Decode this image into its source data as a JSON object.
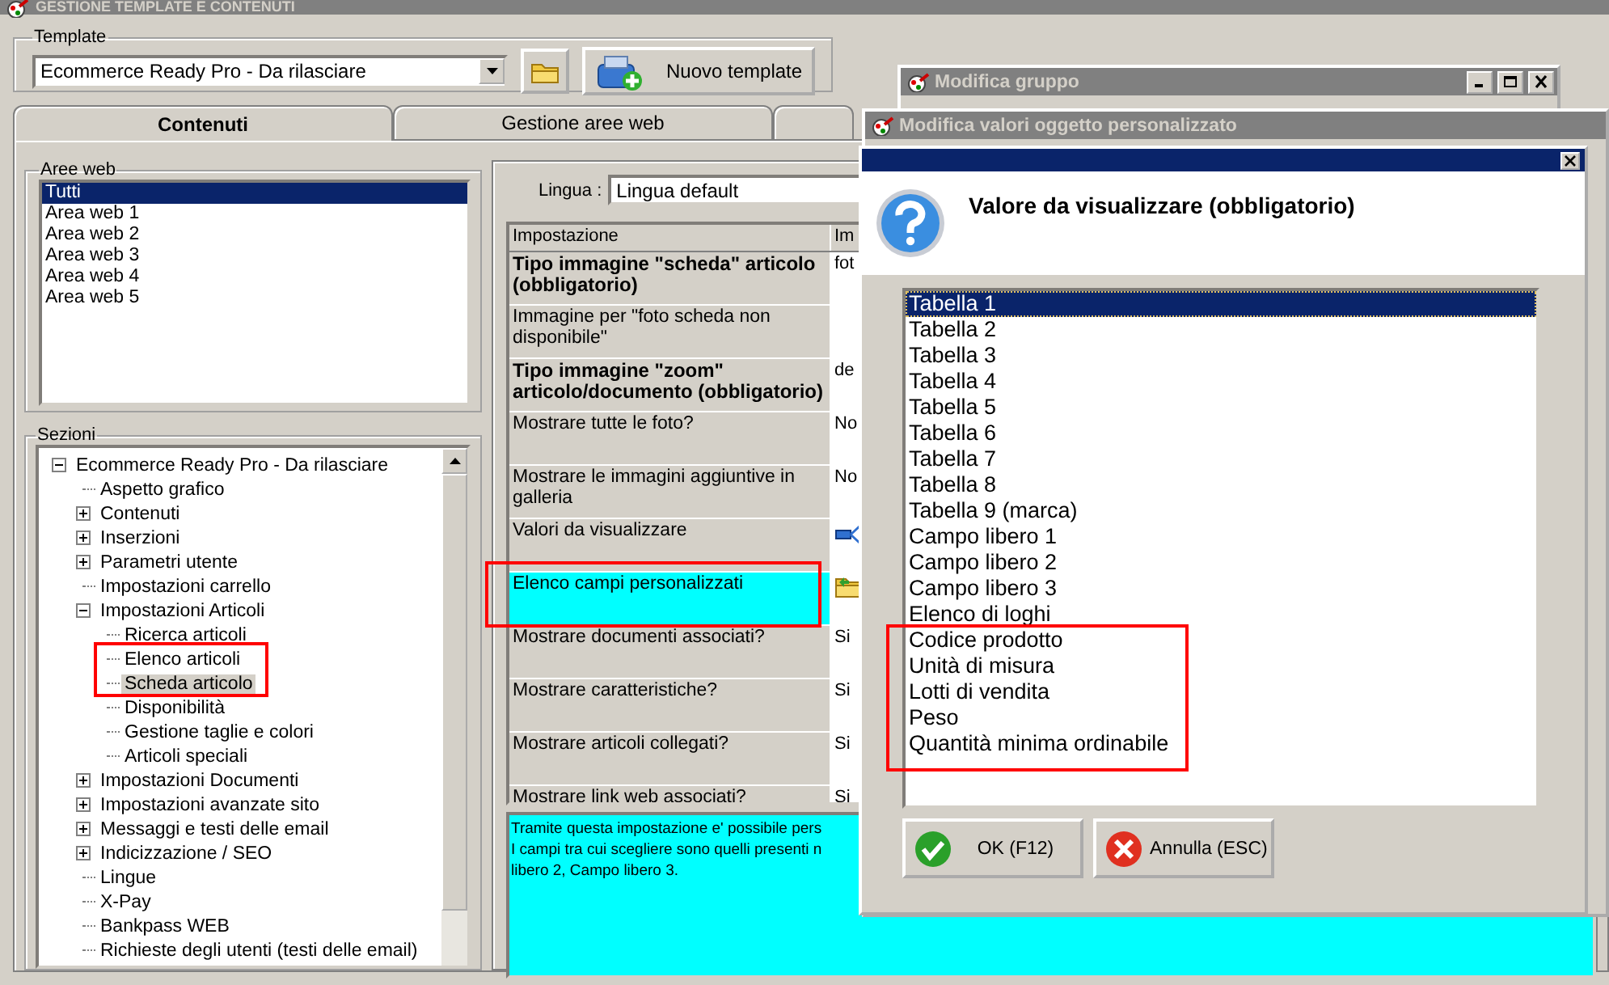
{
  "window": {
    "title": "GESTIONE TEMPLATE E CONTENUTI"
  },
  "template": {
    "label": "Template",
    "value": "Ecommerce Ready Pro - Da rilasciare",
    "new_button": "Nuovo template"
  },
  "tabs": [
    {
      "label": "Contenuti",
      "selected": true
    },
    {
      "label": "Gestione aree web",
      "selected": false
    }
  ],
  "web_areas": {
    "label": "Aree web",
    "items": [
      {
        "label": "Tutti",
        "selected": true
      },
      {
        "label": "Area web 1",
        "selected": false
      },
      {
        "label": "Area web 2",
        "selected": false
      },
      {
        "label": "Area web 3",
        "selected": false
      },
      {
        "label": "Area web 4",
        "selected": false
      },
      {
        "label": "Area web 5",
        "selected": false
      }
    ]
  },
  "sections": {
    "label": "Sezioni",
    "tree": [
      {
        "label": "Ecommerce Ready Pro - Da rilasciare",
        "expanded": true,
        "selected": false,
        "children": [
          {
            "label": "Aspetto grafico",
            "selected": false
          },
          {
            "label": "Contenuti",
            "expanded": false,
            "selected": false
          },
          {
            "label": "Inserzioni",
            "expanded": false,
            "selected": false
          },
          {
            "label": "Parametri utente",
            "expanded": false,
            "selected": false
          },
          {
            "label": "Impostazioni carrello",
            "selected": false
          },
          {
            "label": "Impostazioni Articoli",
            "expanded": true,
            "selected": false,
            "children": [
              {
                "label": "Ricerca articoli",
                "selected": false
              },
              {
                "label": "Elenco articoli",
                "selected": false
              },
              {
                "label": "Scheda articolo",
                "selected": true
              },
              {
                "label": "Disponibilità",
                "selected": false
              },
              {
                "label": "Gestione taglie e colori",
                "selected": false
              },
              {
                "label": "Articoli speciali",
                "selected": false
              }
            ]
          },
          {
            "label": "Impostazioni Documenti",
            "expanded": false,
            "selected": false
          },
          {
            "label": "Impostazioni avanzate sito",
            "expanded": false,
            "selected": false
          },
          {
            "label": "Messaggi e testi delle email",
            "expanded": false,
            "selected": false
          },
          {
            "label": "Indicizzazione / SEO",
            "expanded": false,
            "selected": false
          },
          {
            "label": "Lingue",
            "selected": false
          },
          {
            "label": "X-Pay",
            "selected": false
          },
          {
            "label": "Bankpass WEB",
            "selected": false
          },
          {
            "label": "Richieste degli utenti (testi delle email)",
            "selected": false
          }
        ]
      }
    ]
  },
  "language": {
    "label": "Lingua :",
    "value": "Lingua default"
  },
  "settings_table": {
    "columns": [
      "Impostazione",
      "Im"
    ],
    "rows": [
      {
        "setting": "Tipo immagine \"scheda\" articolo (obbligatorio)",
        "bold": true,
        "selected": false,
        "kind": "text",
        "value": "fot"
      },
      {
        "setting": "Immagine per \"foto scheda non disponibile\"",
        "bold": false,
        "selected": false,
        "kind": "text"
      },
      {
        "setting": "Tipo immagine \"zoom\" articolo/documento (obbligatorio)",
        "bold": true,
        "selected": false,
        "kind": "text",
        "value": "de"
      },
      {
        "setting": "Mostrare tutte le foto?",
        "bold": false,
        "selected": false,
        "kind": "text",
        "value": "No"
      },
      {
        "setting": "Mostrare le immagini aggiuntive in galleria",
        "bold": false,
        "selected": false,
        "kind": "text",
        "value": "No"
      },
      {
        "setting": "Valori da visualizzare",
        "bold": false,
        "selected": false,
        "kind": "relations"
      },
      {
        "setting": "Elenco campi personalizzati",
        "bold": false,
        "selected": true,
        "kind": "folder"
      },
      {
        "setting": "Mostrare documenti associati?",
        "bold": false,
        "selected": false,
        "kind": "text",
        "value": "Si"
      },
      {
        "setting": "Mostrare caratteristiche?",
        "bold": false,
        "selected": false,
        "kind": "text",
        "value": "Si"
      },
      {
        "setting": "Mostrare articoli collegati?",
        "bold": false,
        "selected": false,
        "kind": "text",
        "value": "Si"
      },
      {
        "setting": "Mostrare link web associati?",
        "bold": false,
        "selected": false,
        "kind": "text",
        "value": "Si"
      }
    ]
  },
  "description": {
    "lines": [
      "Tramite questa impostazione e' possibile pers",
      "I campi tra cui scegliere sono quelli presenti n",
      "libero 2, Campo libero 3."
    ]
  },
  "windows": [
    {
      "title": "Modifica gruppo"
    },
    {
      "title": "Modifica valori oggetto personalizzato"
    }
  ],
  "dialog": {
    "heading": "Valore da visualizzare (obbligatorio)",
    "options": [
      {
        "label": "Tabella 1",
        "selected": true
      },
      {
        "label": "Tabella 2",
        "selected": false
      },
      {
        "label": "Tabella 3",
        "selected": false
      },
      {
        "label": "Tabella 4",
        "selected": false
      },
      {
        "label": "Tabella 5",
        "selected": false
      },
      {
        "label": "Tabella 6",
        "selected": false
      },
      {
        "label": "Tabella 7",
        "selected": false
      },
      {
        "label": "Tabella 8",
        "selected": false
      },
      {
        "label": "Tabella 9 (marca)",
        "selected": false
      },
      {
        "label": "Campo libero 1",
        "selected": false
      },
      {
        "label": "Campo libero 2",
        "selected": false
      },
      {
        "label": "Campo libero 3",
        "selected": false
      },
      {
        "label": "Elenco di loghi",
        "selected": false
      },
      {
        "label": "Codice prodotto",
        "selected": false
      },
      {
        "label": "Unità di misura",
        "selected": false
      },
      {
        "label": "Lotti di vendita",
        "selected": false
      },
      {
        "label": "Peso",
        "selected": false
      },
      {
        "label": "Quantità minima ordinabile",
        "selected": false
      }
    ],
    "buttons": [
      {
        "kind": "ok",
        "label": "OK (F12)"
      },
      {
        "kind": "cancel",
        "label": "Annulla (ESC)"
      }
    ]
  }
}
